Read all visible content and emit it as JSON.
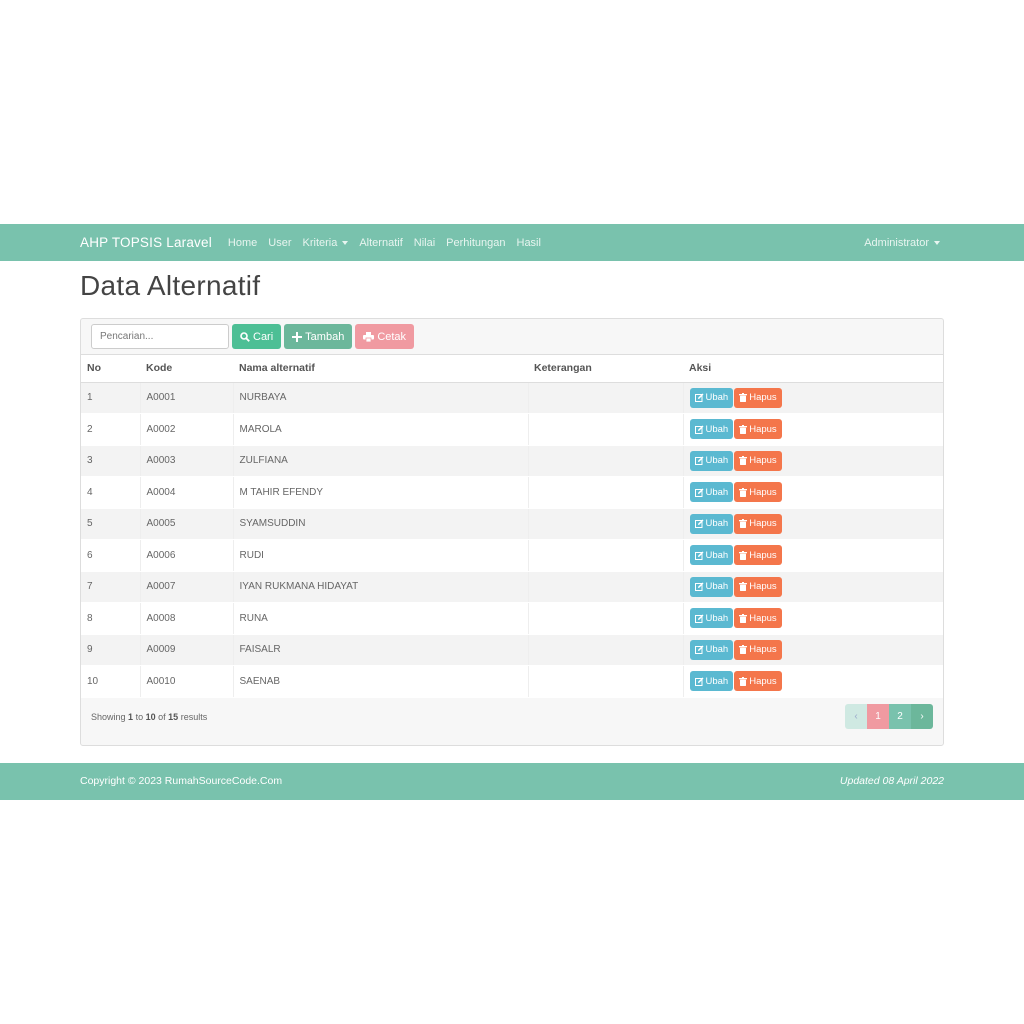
{
  "navbar": {
    "brand": "AHP TOPSIS Laravel",
    "links": [
      "Home",
      "User",
      "Kriteria",
      "Alternatif",
      "Nilai",
      "Perhitungan",
      "Hasil"
    ],
    "user": "Administrator"
  },
  "page": {
    "title": "Data Alternatif"
  },
  "toolbar": {
    "search_placeholder": "Pencarian...",
    "cari": "Cari",
    "tambah": "Tambah",
    "cetak": "Cetak"
  },
  "table": {
    "headers": [
      "No",
      "Kode",
      "Nama alternatif",
      "Keterangan",
      "Aksi"
    ],
    "ubah_label": "Ubah",
    "hapus_label": "Hapus",
    "rows": [
      {
        "no": "1",
        "kode": "A0001",
        "nama": "NURBAYA",
        "keterangan": ""
      },
      {
        "no": "2",
        "kode": "A0002",
        "nama": "MAROLA",
        "keterangan": ""
      },
      {
        "no": "3",
        "kode": "A0003",
        "nama": "ZULFIANA",
        "keterangan": ""
      },
      {
        "no": "4",
        "kode": "A0004",
        "nama": "M TAHIR EFENDY",
        "keterangan": ""
      },
      {
        "no": "5",
        "kode": "A0005",
        "nama": "SYAMSUDDIN",
        "keterangan": ""
      },
      {
        "no": "6",
        "kode": "A0006",
        "nama": "RUDI",
        "keterangan": ""
      },
      {
        "no": "7",
        "kode": "A0007",
        "nama": "IYAN RUKMANA HIDAYAT",
        "keterangan": ""
      },
      {
        "no": "8",
        "kode": "A0008",
        "nama": "RUNA",
        "keterangan": ""
      },
      {
        "no": "9",
        "kode": "A0009",
        "nama": "FAISALR",
        "keterangan": ""
      },
      {
        "no": "10",
        "kode": "A0010",
        "nama": "SAENAB",
        "keterangan": ""
      }
    ]
  },
  "pagination": {
    "showing": "Showing",
    "from": "1",
    "to_word": "to",
    "to": "10",
    "of_word": "of",
    "total": "15",
    "results_word": "results",
    "prev": "‹",
    "pages": [
      "1",
      "2"
    ],
    "next": "›"
  },
  "footer": {
    "copyright": "Copyright © 2023 RumahSourceCode.Com",
    "updated": "Updated 08 April 2022"
  },
  "colors": {
    "navbar": "#79c2ad",
    "cari": "#4dbf95",
    "tambah": "#6cb79b",
    "cetak": "#f09aa1",
    "ubah": "#5bb9d1",
    "hapus": "#f4764b"
  }
}
